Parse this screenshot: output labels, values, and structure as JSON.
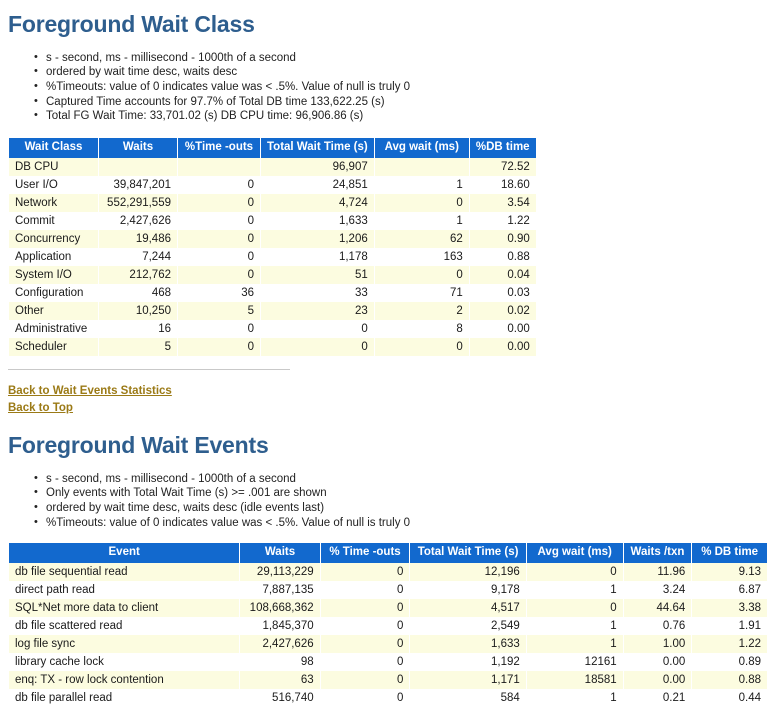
{
  "colors": {
    "heading": "#2e5e8e",
    "table_header_bg": "#1269ce",
    "table_header_fg": "#ffffff",
    "row_odd_bg": "#fcfce0",
    "row_even_bg": "#ffffff",
    "link": "#9b7a16"
  },
  "sections": [
    {
      "title": "Foreground Wait Class",
      "notes": [
        "s - second, ms - millisecond - 1000th of a second",
        "ordered by wait time desc, waits desc",
        "%Timeouts: value of 0 indicates value was < .5%. Value of null is truly 0",
        "Captured Time accounts for 97.7% of Total DB time 133,622.25 (s)",
        "Total FG Wait Time: 33,701.02 (s) DB CPU time: 96,906.86 (s)"
      ],
      "table": {
        "columns": [
          "Wait Class",
          "Waits",
          "%Time -outs",
          "Total Wait Time (s)",
          "Avg wait (ms)",
          "%DB time"
        ],
        "rows": [
          [
            "DB CPU",
            "",
            "",
            "96,907",
            "",
            "72.52"
          ],
          [
            "User I/O",
            "39,847,201",
            "0",
            "24,851",
            "1",
            "18.60"
          ],
          [
            "Network",
            "552,291,559",
            "0",
            "4,724",
            "0",
            "3.54"
          ],
          [
            "Commit",
            "2,427,626",
            "0",
            "1,633",
            "1",
            "1.22"
          ],
          [
            "Concurrency",
            "19,486",
            "0",
            "1,206",
            "62",
            "0.90"
          ],
          [
            "Application",
            "7,244",
            "0",
            "1,178",
            "163",
            "0.88"
          ],
          [
            "System I/O",
            "212,762",
            "0",
            "51",
            "0",
            "0.04"
          ],
          [
            "Configuration",
            "468",
            "36",
            "33",
            "71",
            "0.03"
          ],
          [
            "Other",
            "10,250",
            "5",
            "23",
            "2",
            "0.02"
          ],
          [
            "Administrative",
            "16",
            "0",
            "0",
            "8",
            "0.00"
          ],
          [
            "Scheduler",
            "5",
            "0",
            "0",
            "0",
            "0.00"
          ]
        ]
      }
    },
    {
      "title": "Foreground Wait Events",
      "notes": [
        "s - second, ms - millisecond - 1000th of a second",
        "Only events with Total Wait Time (s) >= .001 are shown",
        "ordered by wait time desc, waits desc (idle events last)",
        "%Timeouts: value of 0 indicates value was < .5%. Value of null is truly 0"
      ],
      "table": {
        "columns": [
          "Event",
          "Waits",
          "% Time -outs",
          "Total Wait Time (s)",
          "Avg wait (ms)",
          "Waits /txn",
          "% DB time"
        ],
        "rows": [
          [
            "db file sequential read",
            "29,113,229",
            "0",
            "12,196",
            "0",
            "11.96",
            "9.13"
          ],
          [
            "direct path read",
            "7,887,135",
            "0",
            "9,178",
            "1",
            "3.24",
            "6.87"
          ],
          [
            "SQL*Net more data to client",
            "108,668,362",
            "0",
            "4,517",
            "0",
            "44.64",
            "3.38"
          ],
          [
            "db file scattered read",
            "1,845,370",
            "0",
            "2,549",
            "1",
            "0.76",
            "1.91"
          ],
          [
            "log file sync",
            "2,427,626",
            "0",
            "1,633",
            "1",
            "1.00",
            "1.22"
          ],
          [
            "library cache lock",
            "98",
            "0",
            "1,192",
            "12161",
            "0.00",
            "0.89"
          ],
          [
            "enq: TX - row lock contention",
            "63",
            "0",
            "1,171",
            "18581",
            "0.00",
            "0.88"
          ],
          [
            "db file parallel read",
            "516,740",
            "0",
            "584",
            "1",
            "0.21",
            "0.44"
          ]
        ]
      }
    }
  ],
  "links": [
    {
      "label": "Back to Wait Events Statistics"
    },
    {
      "label": "Back to Top"
    }
  ]
}
